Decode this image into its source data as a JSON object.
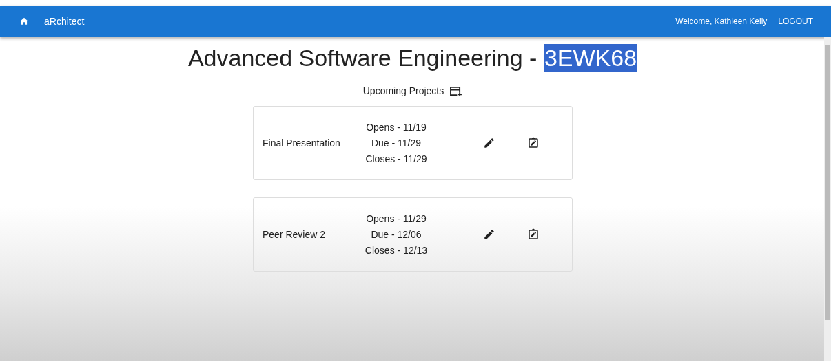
{
  "app_bar": {
    "app_name": "aRchitect",
    "welcome": "Welcome, Kathleen Kelly",
    "logout": "LOGOUT"
  },
  "course": {
    "title": "Advanced Software Engineering - ",
    "code": "3EWK68",
    "code_selected": true
  },
  "section": {
    "title": "Upcoming Projects"
  },
  "projects": [
    {
      "name": "Final Presentation",
      "opens": "Opens - 11/19",
      "due": "Due - 11/29",
      "closes": "Closes - 11/29"
    },
    {
      "name": "Peer Review 2",
      "opens": "Opens - 11/29",
      "due": "Due - 12/06",
      "closes": "Closes - 12/13"
    }
  ]
}
